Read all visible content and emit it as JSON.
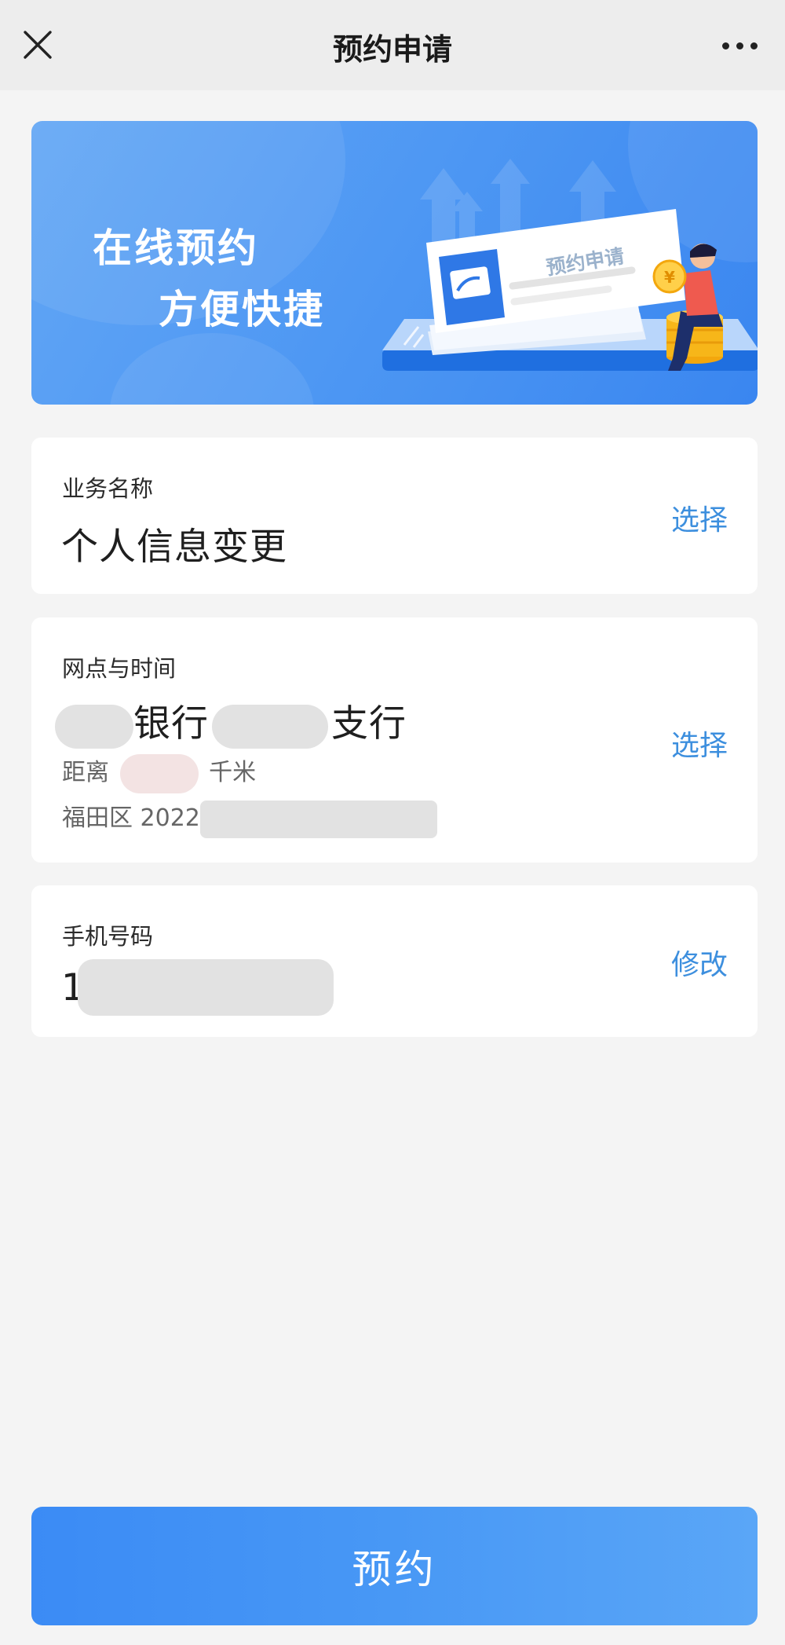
{
  "header": {
    "title": "预约申请",
    "close_icon": "close-icon",
    "more_icon": "more-horizontal-icon"
  },
  "banner": {
    "line1": "在线预约",
    "line2": "方便快捷",
    "card_label": "预约申请",
    "coin_symbol": "¥"
  },
  "business": {
    "label": "业务名称",
    "value": "个人信息变更",
    "action": "选择"
  },
  "branch": {
    "label": "网点与时间",
    "name_part1": "银行",
    "name_part2": "支行",
    "distance_prefix": "距离",
    "distance_unit": "千米",
    "address_prefix": "福田区 2022",
    "action": "选择"
  },
  "phone": {
    "label": "手机号码",
    "value_prefix": "1",
    "action": "修改"
  },
  "submit": {
    "label": "预约"
  },
  "colors": {
    "accent": "#3d8fde",
    "button": "#4898f5",
    "banner": "#4d97f3",
    "background": "#f4f4f4"
  }
}
